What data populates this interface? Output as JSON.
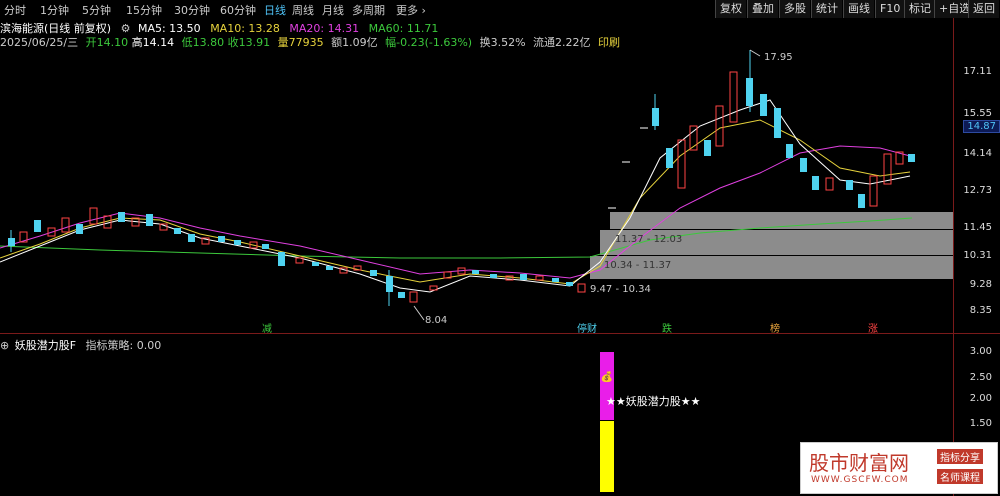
{
  "topbar": {
    "tabs": [
      "分时",
      "1分钟",
      "5分钟",
      "15分钟",
      "30分钟",
      "60分钟",
      "日线",
      "周线",
      "月线",
      "多周期",
      "更多 ›"
    ],
    "active_tab": "日线",
    "buttons": [
      "复权",
      "叠加",
      "多股",
      "统计",
      "画线",
      "F10",
      "标记",
      "+自选",
      "返回"
    ]
  },
  "info": {
    "name": "滨海能源(日线 前复权)",
    "ma5": "MA5: 13.50",
    "ma10": "MA10: 13.28",
    "ma20": "MA20: 14.31",
    "ma60": "MA60: 11.71",
    "date": "2025/06/25/三",
    "open": "开14.10",
    "high": "高14.14",
    "low": "低13.80",
    "close": "收13.91",
    "vol": "量77935",
    "amount": "额1.09亿",
    "change": "幅-0.23(-1.63%)",
    "turnover": "换3.52%",
    "float": "流通2.22亿",
    "print": "印刷"
  },
  "axis_top": [
    "17.11",
    "15.55",
    "14.14",
    "12.73",
    "11.45",
    "10.31",
    "9.28",
    "8.35"
  ],
  "current_price": "14.87",
  "annotations": {
    "high": "17.95",
    "low": "8.04",
    "zone1": "11.37 - 12.03",
    "zone2": "10.34 - 11.37",
    "zone3": "9.47 - 10.34"
  },
  "signals": [
    "减",
    "停财",
    "跌",
    "榜",
    "涨"
  ],
  "indicator": {
    "title": "妖股潜力股F",
    "strategy": "指标策略: 0.00",
    "label": "★★妖股潜力股★★",
    "axis": [
      "3.00",
      "2.50",
      "2.00",
      "1.50"
    ]
  },
  "watermark": {
    "main": "股市财富网",
    "tag1": "指标分享",
    "tag2": "名师课程",
    "url": "WWW.GSCFW.COM"
  },
  "colors": {
    "up": "#ff4444",
    "down": "#4fd3f0",
    "ma5": "#ffffff",
    "ma10": "#e6d23c",
    "ma20": "#e040e0",
    "ma60": "#3cc83c"
  }
}
